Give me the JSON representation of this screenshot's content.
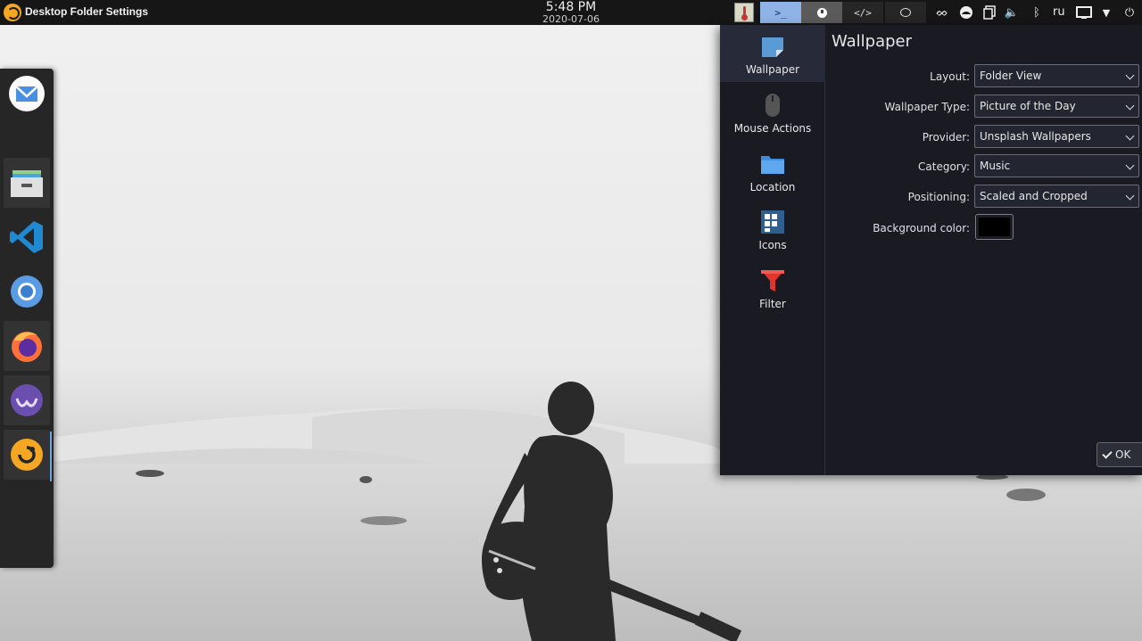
{
  "top_panel": {
    "window_title": "Desktop Folder Settings",
    "clock_time": "5:48 PM",
    "clock_date": "2020-07-06",
    "task_buttons": [
      {
        "name": "terminal",
        "label": ">_"
      },
      {
        "name": "record",
        "label": ""
      },
      {
        "name": "code",
        "label": "</>"
      },
      {
        "name": "chat",
        "label": ""
      }
    ],
    "tray_icons": [
      "flame-icon",
      "cloud-icon",
      "clipboard-icon",
      "volume-icon",
      "bluetooth-icon"
    ],
    "keyboard_layout": "ru",
    "tray_glyphs": {
      "flame": "ᨖ",
      "volume": "🔈",
      "bluetooth": "ᛒ",
      "menu": "▼",
      "power": "⏻"
    }
  },
  "dock": {
    "items": [
      "mail-icon",
      "file-manager-icon",
      "vscode-icon",
      "chromium-icon",
      "firefox-icon",
      "nextcloud-icon",
      "app-logo-icon"
    ]
  },
  "settings": {
    "categories": [
      {
        "id": "wallpaper",
        "label": "Wallpaper"
      },
      {
        "id": "mouse",
        "label": "Mouse Actions"
      },
      {
        "id": "location",
        "label": "Location"
      },
      {
        "id": "icons",
        "label": "Icons"
      },
      {
        "id": "filter",
        "label": "Filter"
      }
    ],
    "selected_category": "Wallpaper",
    "page_title": "Wallpaper",
    "fields": [
      {
        "label": "Layout:",
        "value": "Folder View"
      },
      {
        "label": "Wallpaper Type:",
        "value": "Picture of the Day"
      },
      {
        "label": "Provider:",
        "value": "Unsplash Wallpapers"
      },
      {
        "label": "Category:",
        "value": "Music"
      },
      {
        "label": "Positioning:",
        "value": "Scaled and Cropped"
      }
    ],
    "background_color_label": "Background color:",
    "background_color": "#000000",
    "ok_label": "OK"
  },
  "colors": {
    "accent": "#8fb3e6",
    "panel": "#161616",
    "dialog": "#191a22"
  }
}
